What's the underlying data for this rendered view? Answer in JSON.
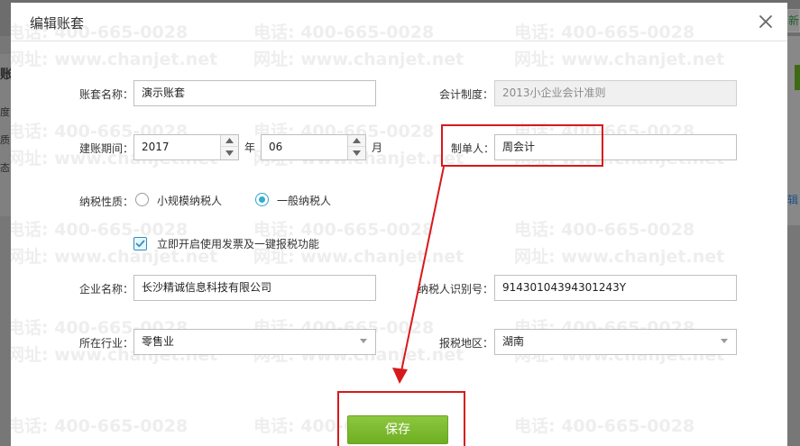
{
  "modal": {
    "title": "编辑账套"
  },
  "watermark": {
    "phone": "电话: 400-665-0028",
    "site": "网址: www.chanjet.net"
  },
  "background": {
    "left_chars": [
      "账",
      "度",
      "质",
      "态"
    ],
    "right_button": "新",
    "right_link": "辑"
  },
  "form": {
    "account_name": {
      "label": "账套名称：",
      "value": "演示账套"
    },
    "accounting_system": {
      "label": "会计制度：",
      "value": "2013小企业会计准则"
    },
    "period": {
      "label": "建账期间：",
      "year": "2017",
      "year_unit": "年",
      "month": "06",
      "month_unit": "月"
    },
    "preparer": {
      "label": "制单人：",
      "value": "周会计"
    },
    "tax_type": {
      "label": "纳税性质：",
      "options": [
        {
          "label": "小规模纳税人",
          "checked": false
        },
        {
          "label": "一般纳税人",
          "checked": true
        }
      ]
    },
    "invoice_feature": {
      "label": "立即开启使用发票及一键报税功能",
      "checked": true
    },
    "company_name": {
      "label": "企业名称：",
      "value": "长沙精诚信息科技有限公司"
    },
    "taxpayer_id": {
      "label": "纳税人识别号：",
      "value": "91430104394301243Y"
    },
    "industry": {
      "label": "所在行业：",
      "value": "零售业"
    },
    "tax_region": {
      "label": "报税地区：",
      "value": "湖南"
    }
  },
  "save_label": "保存",
  "colors": {
    "accent_green": "#7dbb2f",
    "annotation_red": "#d8191c",
    "radio_blue": "#34abd2"
  }
}
